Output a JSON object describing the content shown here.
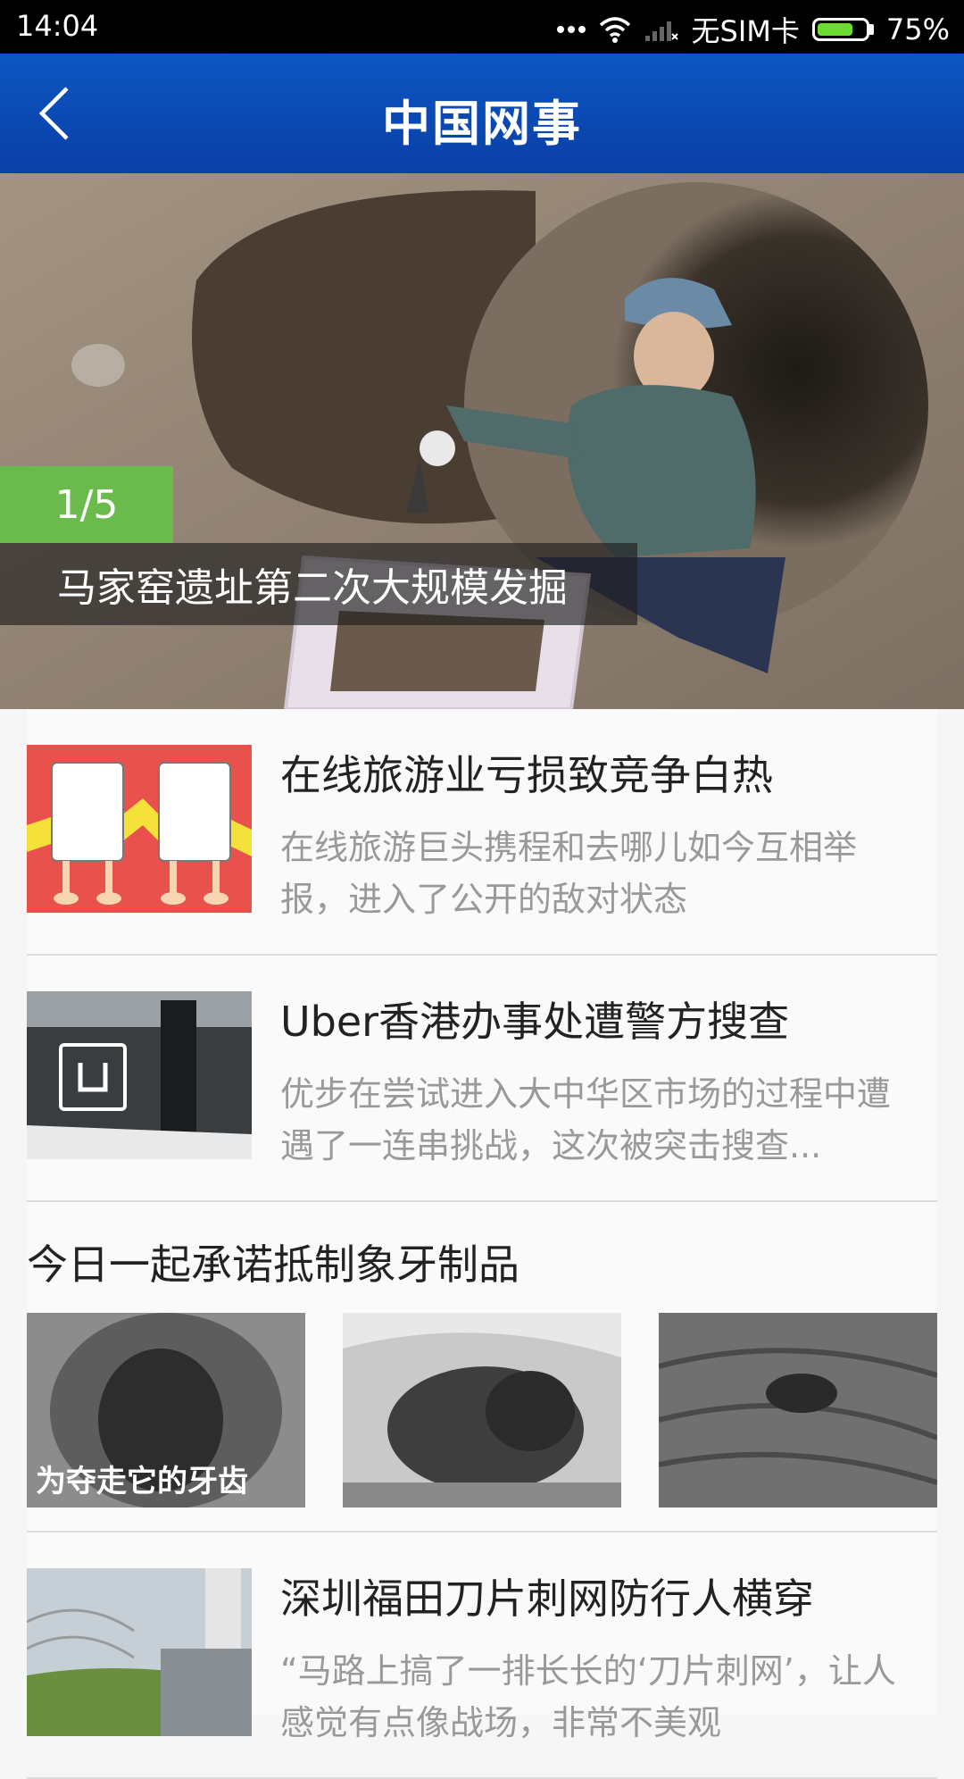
{
  "status": {
    "time": "14:04",
    "carrier": "无SIM卡",
    "battery_percent": "75%",
    "battery_level": 0.75,
    "icons": [
      "dots-icon",
      "wifi-icon",
      "signal-icon",
      "battery-icon"
    ]
  },
  "appbar": {
    "title": "中国网事",
    "back_icon": "back-chevron-icon"
  },
  "hero": {
    "counter": "1/5",
    "caption": "马家窑遗址第二次大规模发掘"
  },
  "articles": [
    {
      "headline": "在线旅游业亏损致竞争白热",
      "summary": "在线旅游巨头携程和去哪儿如今互相举报，进入了公开的敌对状态"
    },
    {
      "headline": "Uber香港办事处遭警方搜查",
      "summary": "优步在尝试进入大中华区市场的过程中遭遇了一连串挑战，这次被突击搜查..."
    },
    {
      "headline": "深圳福田刀片刺网防行人横穿",
      "summary": "“马路上搞了一排长长的‘刀片刺网’，让人感觉有点像战场，非常不美观"
    }
  ],
  "gallery": {
    "title": "今日一起承诺抵制象牙制品",
    "image_overlay_text": "为夺走它的牙齿"
  },
  "colors": {
    "appbar": "#0a4ab4",
    "counter_badge": "#6bbb4c",
    "headline": "#222222",
    "summary": "#999999"
  }
}
